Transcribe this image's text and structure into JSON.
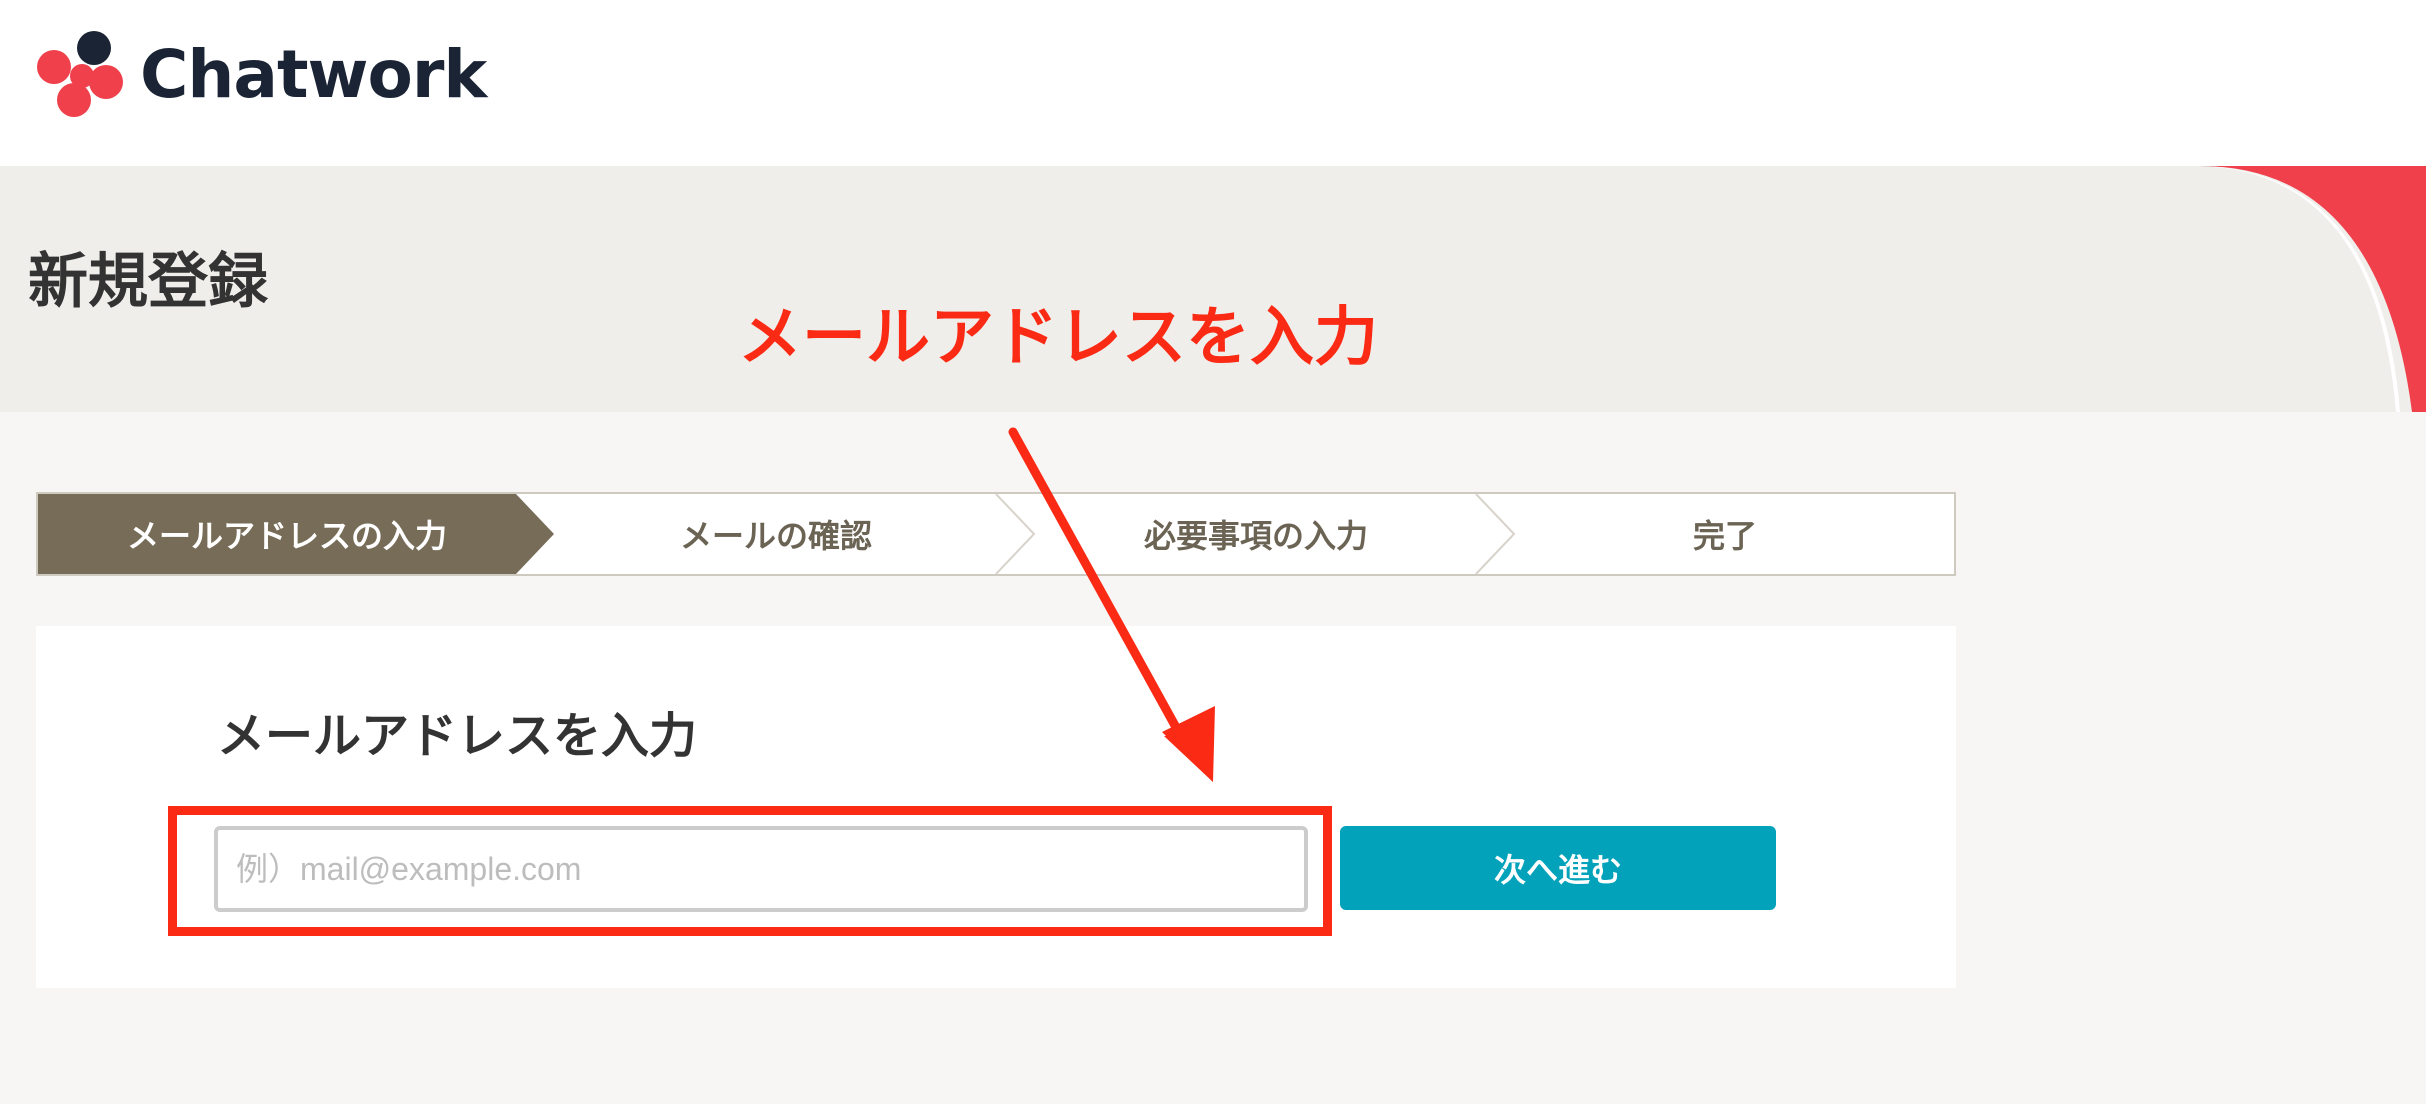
{
  "header": {
    "logo_text": "Chatwork"
  },
  "page": {
    "title": "新規登録"
  },
  "annotation": {
    "label": "メールアドレスを入力"
  },
  "stepper": {
    "steps": [
      {
        "label": "メールアドレスの入力",
        "active": true
      },
      {
        "label": "メールの確認",
        "active": false
      },
      {
        "label": "必要事項の入力",
        "active": false
      },
      {
        "label": "完了",
        "active": false
      }
    ]
  },
  "form": {
    "heading": "メールアドレスを入力",
    "email_placeholder": "例）mail@example.com",
    "email_value": "",
    "next_label": "次へ進む"
  },
  "colors": {
    "brand_red": "#f0404c",
    "brand_navy": "#1a2434",
    "step_active": "#776c58",
    "primary_button": "#02a2ba",
    "annotation": "#fa2a14"
  },
  "icons": {
    "logo_mark": "chatwork-logo-icon",
    "step_separator": "chevron-right-icon",
    "annotation_arrow": "arrow-down-icon"
  }
}
